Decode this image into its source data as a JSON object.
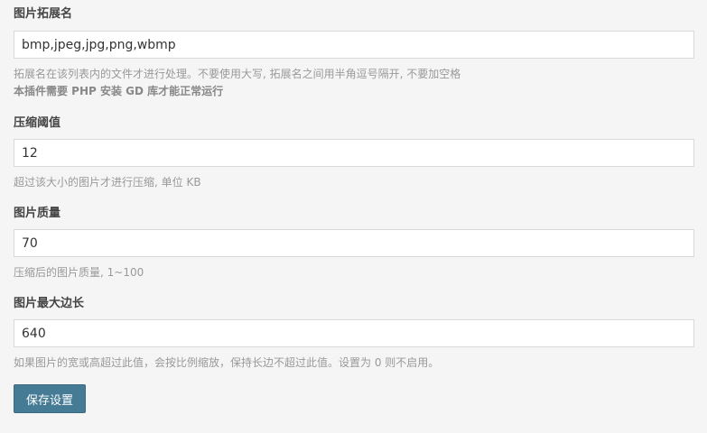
{
  "fields": {
    "extensions": {
      "label": "图片拓展名",
      "value": "bmp,jpeg,jpg,png,wbmp",
      "description": "拓展名在该列表内的文件才进行处理。不要使用大写, 拓展名之间用半角逗号隔开, 不要加空格",
      "note": "本插件需要 PHP 安装 GD 库才能正常运行"
    },
    "threshold": {
      "label": "压缩阈值",
      "value": "12",
      "description": "超过该大小的图片才进行压缩, 单位 KB"
    },
    "quality": {
      "label": "图片质量",
      "value": "70",
      "description": "压缩后的图片质量, 1~100"
    },
    "max_edge": {
      "label": "图片最大边长",
      "value": "640",
      "description": "如果图片的宽或高超过此值，会按比例缩放，保持长边不超过此值。设置为 0 则不启用。"
    }
  },
  "actions": {
    "save_label": "保存设置"
  },
  "colors": {
    "background": "#f5f5f5",
    "button": "#467b96",
    "input_border": "#d9d9d6"
  }
}
